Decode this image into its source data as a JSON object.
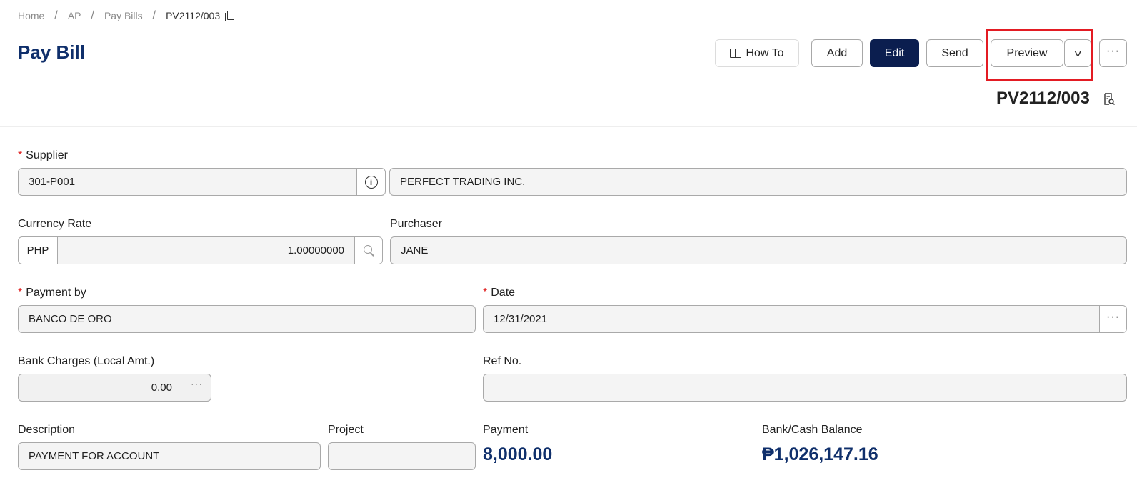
{
  "breadcrumb": {
    "home": "Home",
    "ap": "AP",
    "pay_bills": "Pay Bills",
    "current": "PV2112/003",
    "separator": "/"
  },
  "page": {
    "title": "Pay Bill",
    "doc_number": "PV2112/003"
  },
  "toolbar": {
    "howto_label": "How To",
    "add_label": "Add",
    "edit_label": "Edit",
    "send_label": "Send",
    "preview_label": "Preview",
    "caret_glyph": "v",
    "more_glyph": "···"
  },
  "form": {
    "required_mark": "*",
    "supplier": {
      "label": "Supplier",
      "code": "301-P001",
      "name": "PERFECT TRADING INC."
    },
    "currency_rate": {
      "label": "Currency Rate",
      "currency": "PHP",
      "rate": "1.00000000"
    },
    "purchaser": {
      "label": "Purchaser",
      "value": "JANE"
    },
    "payment_by": {
      "label": "Payment by",
      "value": "BANCO DE ORO"
    },
    "date": {
      "label": "Date",
      "value": "12/31/2021",
      "more_glyph": "···"
    },
    "bank_charges": {
      "label": "Bank Charges (Local Amt.)",
      "value": "0.00",
      "more_glyph": "···"
    },
    "ref_no": {
      "label": "Ref No.",
      "value": ""
    },
    "description": {
      "label": "Description",
      "value": "PAYMENT FOR ACCOUNT"
    },
    "project": {
      "label": "Project",
      "value": ""
    },
    "payment": {
      "label": "Payment",
      "value": "8,000.00"
    },
    "bank_cash_balance": {
      "label": "Bank/Cash Balance",
      "value": "₱1,026,147.16"
    }
  },
  "colors": {
    "brand_navy": "#0f2f6b",
    "edit_button": "#0b1e4f",
    "highlight_red": "#e31b23",
    "required": "#e02020"
  }
}
